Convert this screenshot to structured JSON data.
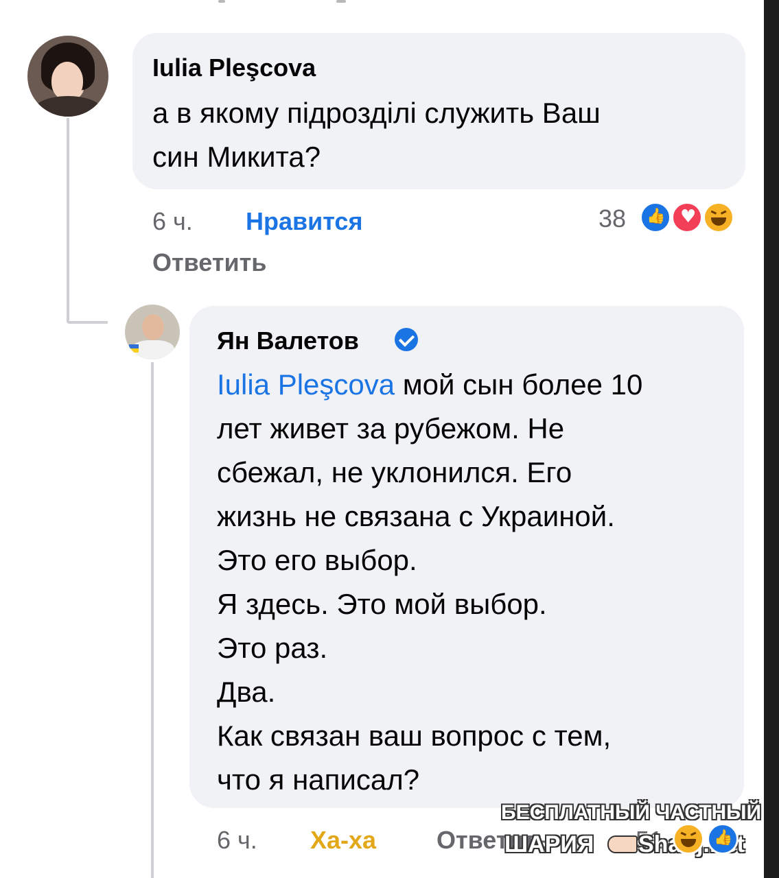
{
  "comment": {
    "author": "Iulia Pleşcova",
    "text_lines": [
      "а в якому підрозділі служить Ваш",
      "син Микита?"
    ],
    "time": "6 ч.",
    "like_label": "Нравится",
    "reply_label": "Ответить",
    "reaction_count": "38",
    "reactions": [
      "like-icon",
      "love-icon",
      "haha-icon"
    ]
  },
  "reply": {
    "author": "Ян Валетов",
    "verified": true,
    "mention": "Iulia Pleşcova",
    "first_line_rest": " мой сын более 10",
    "text_lines": [
      "лет живет за рубежом. Не",
      "сбежал, не уклонился. Его",
      "жизнь не связана с Украиной.",
      "Это его выбор.",
      "Я здесь. Это мой выбор.",
      "Это раз.",
      "Два.",
      "Как связан ваш вопрос с тем,",
      "что я написал?"
    ],
    "time": "6 ч.",
    "reaction_label": "Ха-ха",
    "reply_label": "Ответить",
    "reaction_count": "51",
    "reactions": [
      "haha-icon",
      "like-icon"
    ]
  },
  "watermark": {
    "line1": "БЕСПЛАТНЫЙ ЧАСТНЫЙ",
    "line2_left": "ШАРИЯ",
    "line2_right": "Sharij.net"
  },
  "colors": {
    "bubble": "#f0f2f5",
    "link_blue": "#1b74e4",
    "meta_gray": "#65676b",
    "haha_yellow": "#e3a81a"
  }
}
